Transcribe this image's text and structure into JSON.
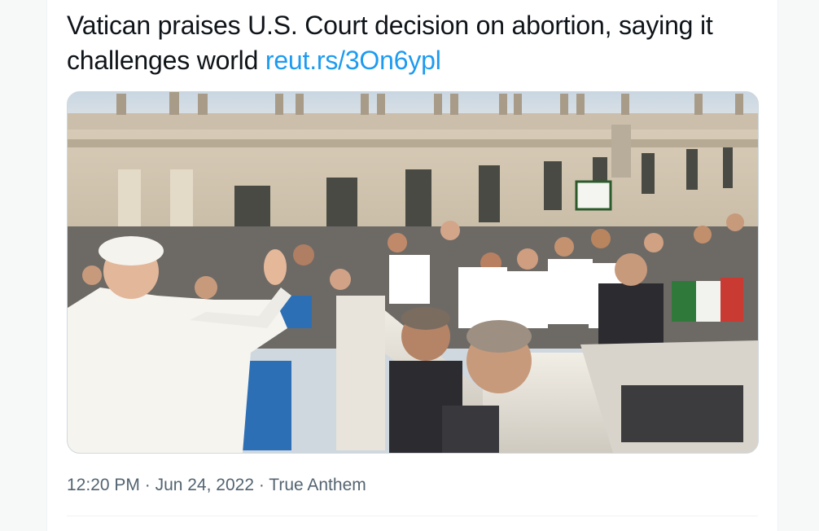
{
  "tweet": {
    "text": "Vatican praises U.S. Court decision on abortion, saying it challenges world ",
    "link": "reut.rs/3On6ypl",
    "time": "12:20 PM",
    "separator": " · ",
    "date": "Jun 24, 2022",
    "source": "True Anthem",
    "media_description_icon": "photo"
  },
  "colors": {
    "link": "#1d9bf0",
    "text": "#0f1419",
    "meta": "#536471"
  }
}
